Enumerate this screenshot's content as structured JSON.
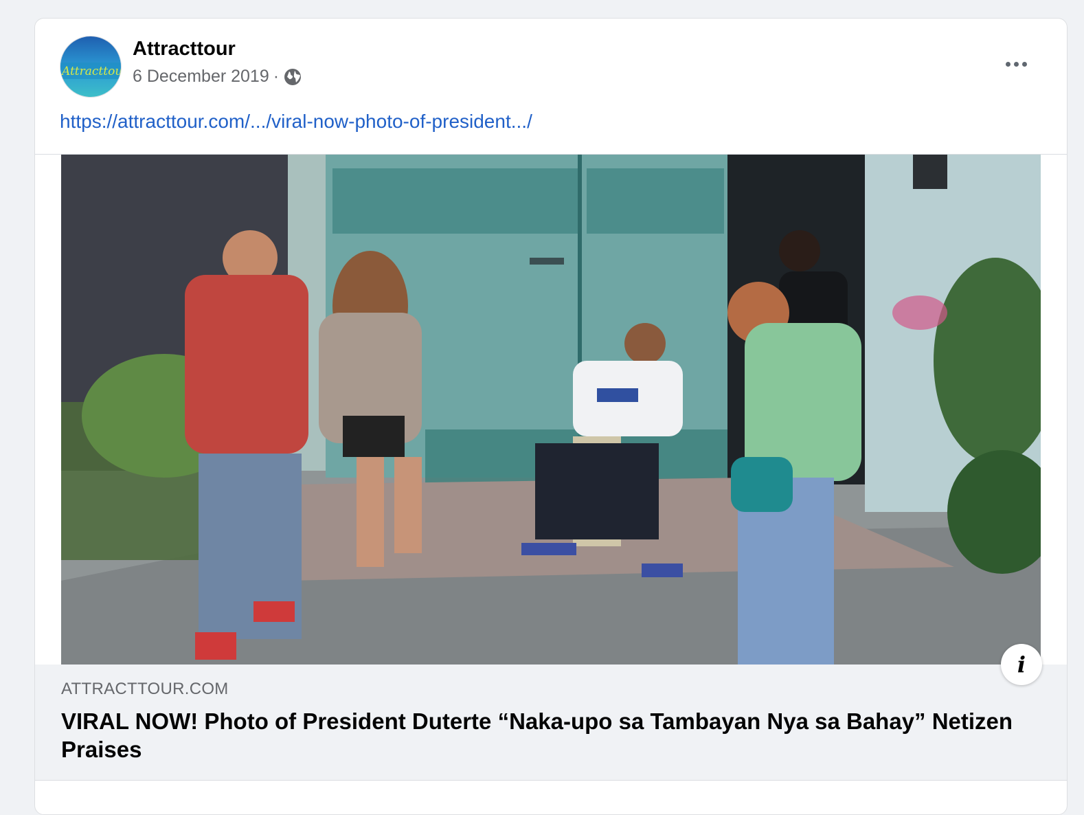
{
  "post": {
    "page_name": "Attracttour",
    "avatar_text": "Attracttour",
    "date": "6 December 2019",
    "separator": "·",
    "privacy_icon": "globe-icon",
    "more_icon": "more-options-icon",
    "link_text": "https://attracttour.com/.../viral-now-photo-of-president.../"
  },
  "link_preview": {
    "domain": "ATTRACTTOUR.COM",
    "headline": "VIRAL NOW! Photo of President Duterte “Naka-upo sa Tambayan Nya sa Bahay” Netizen Praises",
    "info_icon": "info-icon",
    "info_glyph": "i"
  },
  "colors": {
    "link": "#2060c8",
    "meta": "#65676b",
    "background": "#f0f2f5"
  }
}
